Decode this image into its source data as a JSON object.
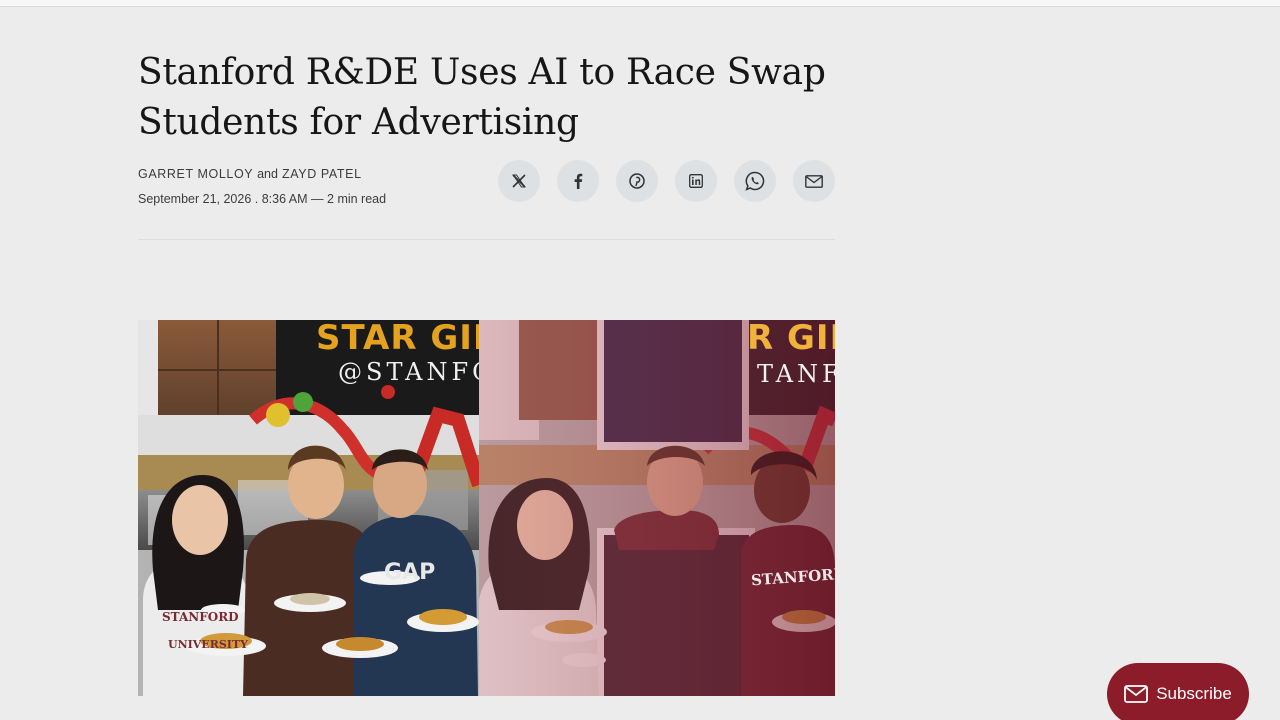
{
  "article": {
    "headline": "Stanford R&DE Uses AI to Race Swap Students for Advertising",
    "author1": "GARRET MOLLOY",
    "and": "and",
    "author2": "ZAYD PATEL",
    "date": "September 21, 2026 . 8:36 AM",
    "separator": " — ",
    "read_time": "2 min read"
  },
  "share": [
    {
      "name": "x",
      "icon": "x-icon"
    },
    {
      "name": "facebook",
      "icon": "facebook-icon"
    },
    {
      "name": "pinterest",
      "icon": "pinterest-icon"
    },
    {
      "name": "linkedin",
      "icon": "linkedin-icon"
    },
    {
      "name": "whatsapp",
      "icon": "whatsapp-icon"
    },
    {
      "name": "email",
      "icon": "mail-icon"
    }
  ],
  "hero_image": {
    "left_sign_main": "STAR GIN",
    "left_sign_sub": "@STANFO",
    "right_sign_main": "R GIN",
    "right_sign_sub": "TANF",
    "shirt_text_left": "STANFORD",
    "shirt_text_center": "GAP",
    "shirt_text_right": "STANFORD",
    "shirt_text_bottom": "UNIVERSITY"
  },
  "subscribe": {
    "label": "Subscribe",
    "icon": "mail-icon"
  },
  "colors": {
    "background": "#ececec",
    "accent": "#8c1c2a",
    "share_bg": "#dde1e4"
  }
}
